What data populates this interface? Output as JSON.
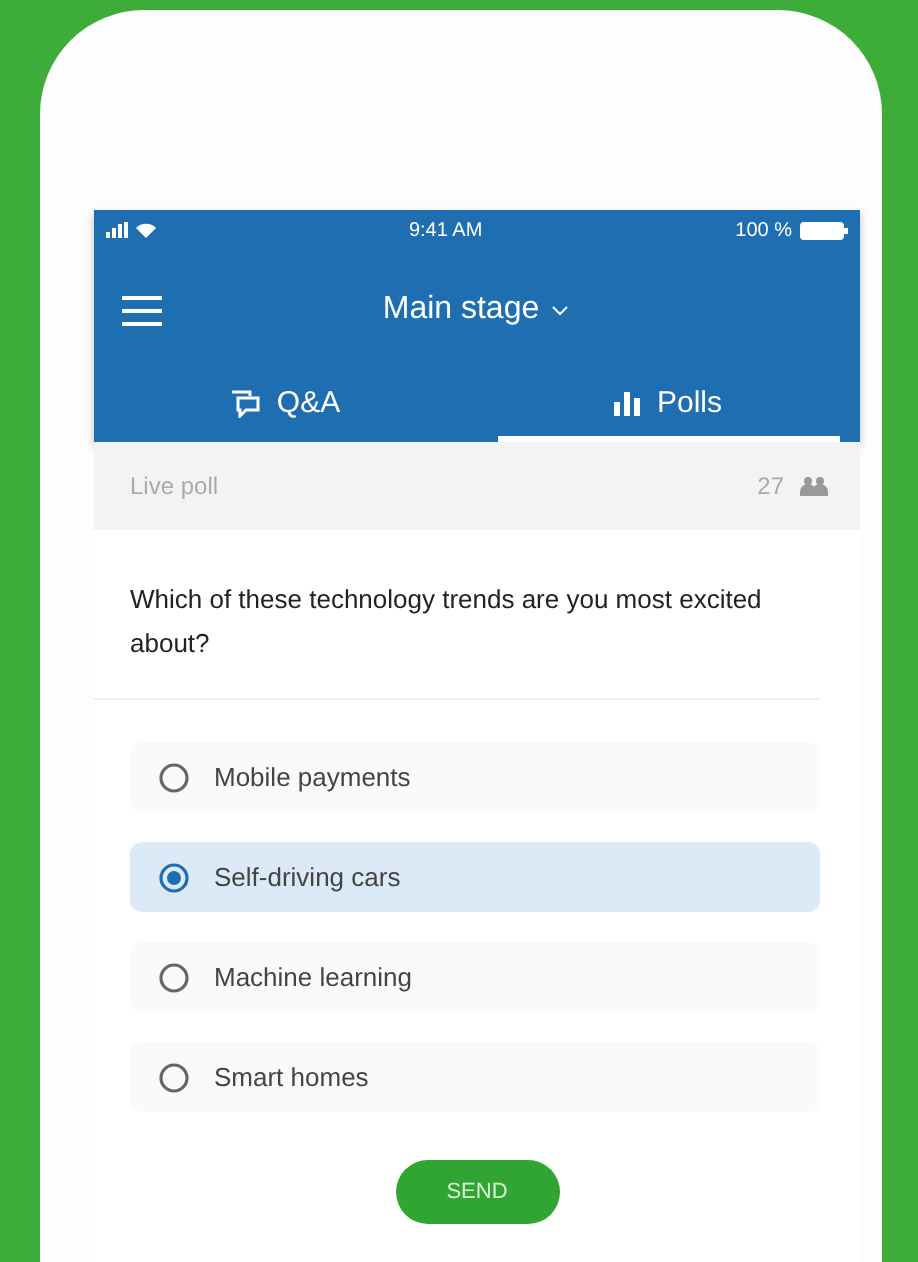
{
  "status_bar": {
    "time": "9:41 AM",
    "battery": "100 %"
  },
  "header": {
    "title": "Main stage"
  },
  "tabs": [
    {
      "label": "Q&A",
      "kind": "qa",
      "selected": false
    },
    {
      "label": "Polls",
      "kind": "polls",
      "selected": true
    }
  ],
  "poll": {
    "label": "Live poll",
    "participants": "27",
    "question": "Which of these technology trends are you most excited about?",
    "options": [
      {
        "label": "Mobile payments",
        "selected": false
      },
      {
        "label": "Self-driving cars",
        "selected": true
      },
      {
        "label": "Machine learning",
        "selected": false
      },
      {
        "label": "Smart homes",
        "selected": false
      }
    ],
    "button": "SEND"
  }
}
